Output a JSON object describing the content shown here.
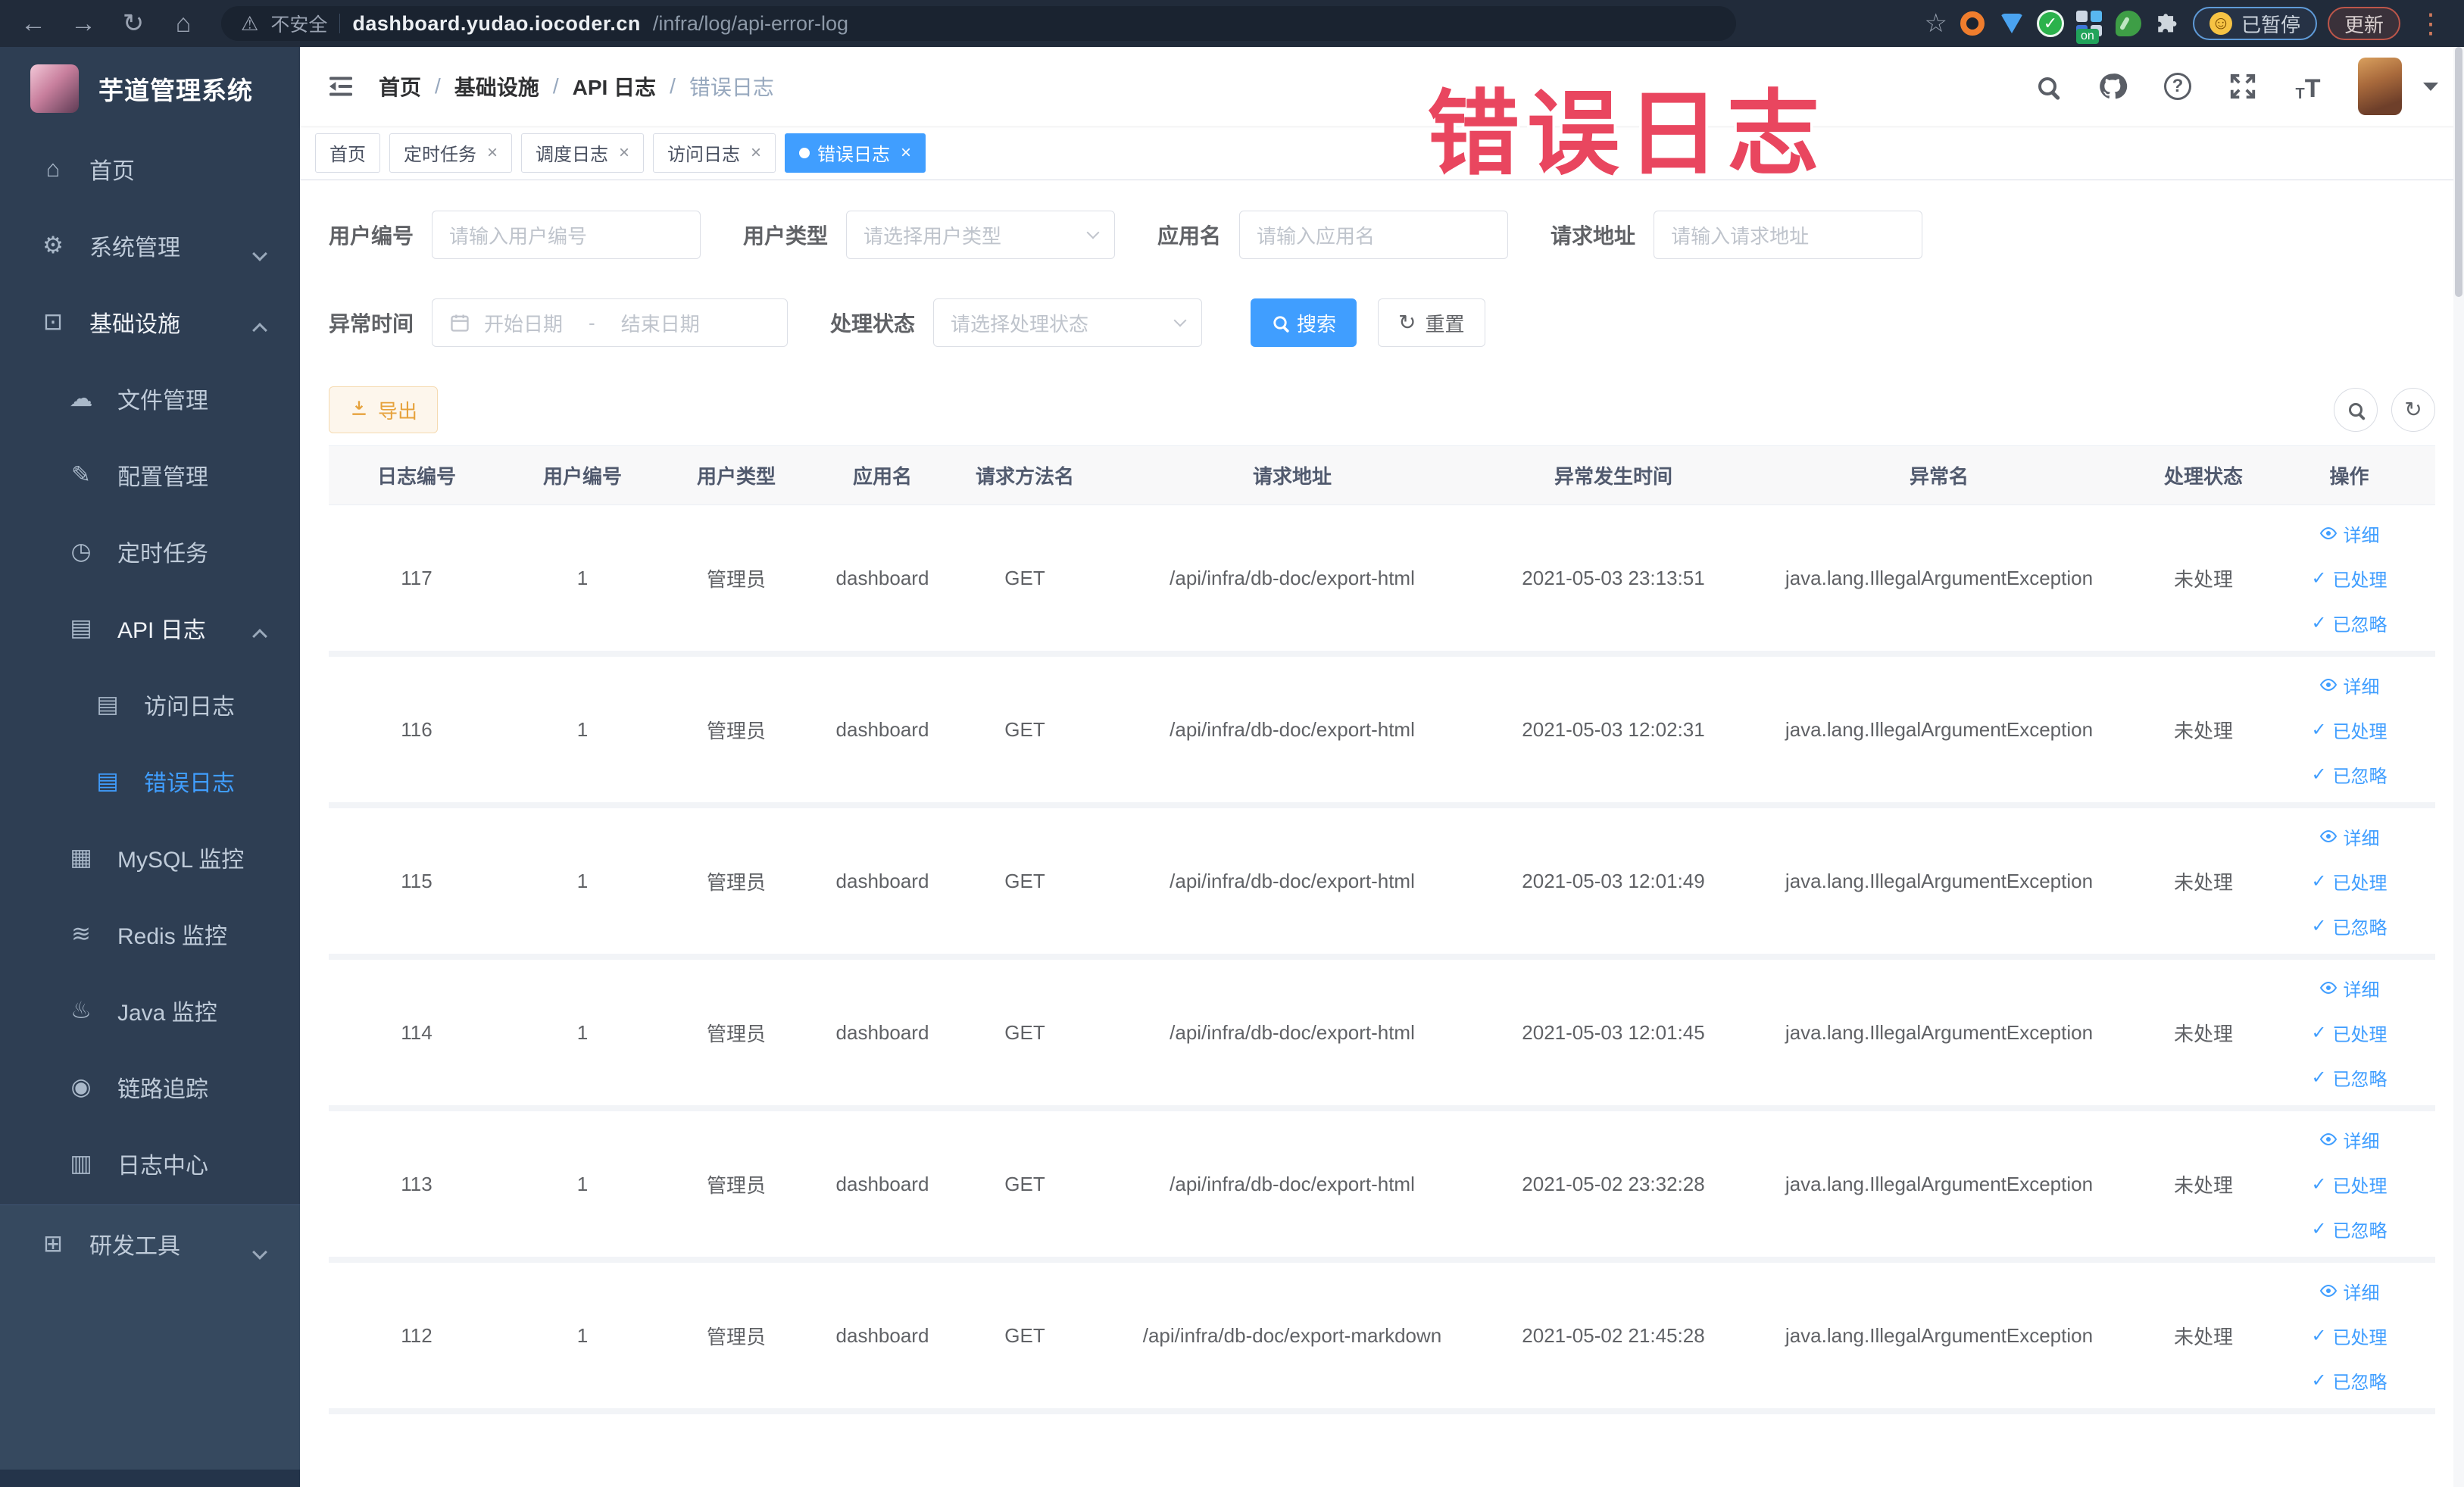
{
  "theme": {
    "accent": "#409eff",
    "warning": "#e6a23c",
    "sidebar_bg": "#2e3e53",
    "sidebar_bg_light": "#36495f",
    "sidebar_text": "#bfcbd9",
    "browser_bar_bg": "#212b3a",
    "annotation_color": "#e9465f"
  },
  "annotation": {
    "text": "错误日志"
  },
  "browser": {
    "security_label": "不安全",
    "url_domain": "dashboard.yudao.iocoder.cn",
    "url_path": "/infra/log/api-error-log",
    "paused_label": "已暂停",
    "update_label": "更新",
    "extension_on_badge": "on"
  },
  "sidebar": {
    "title": "芋道管理系统",
    "items": [
      {
        "id": "home",
        "label": "首页",
        "icon": "home-icon",
        "level": 1
      },
      {
        "id": "system",
        "label": "系统管理",
        "icon": "gear-icon",
        "level": 1,
        "arrow": "down"
      },
      {
        "id": "infra",
        "label": "基础设施",
        "icon": "monitor-icon",
        "level": 1,
        "arrow": "up",
        "highlight": true
      },
      {
        "id": "file",
        "label": "文件管理",
        "icon": "cloud-icon",
        "level": 2
      },
      {
        "id": "config",
        "label": "配置管理",
        "icon": "edit-icon",
        "level": 2
      },
      {
        "id": "job",
        "label": "定时任务",
        "icon": "clock-icon",
        "level": 2
      },
      {
        "id": "api-log",
        "label": "API 日志",
        "icon": "log-icon",
        "level": 2,
        "arrow": "up",
        "highlight": true
      },
      {
        "id": "access-log",
        "label": "访问日志",
        "icon": "log-icon",
        "level": 3
      },
      {
        "id": "error-log",
        "label": "错误日志",
        "icon": "log-icon",
        "level": 3,
        "active": true
      },
      {
        "id": "mysql",
        "label": "MySQL 监控",
        "icon": "database-icon",
        "level": 2
      },
      {
        "id": "redis",
        "label": "Redis 监控",
        "icon": "redis-icon",
        "level": 2
      },
      {
        "id": "java",
        "label": "Java 监控",
        "icon": "java-icon",
        "level": 2
      },
      {
        "id": "trace",
        "label": "链路追踪",
        "icon": "eye-icon",
        "level": 2
      },
      {
        "id": "log-center",
        "label": "日志中心",
        "icon": "log-center-icon",
        "level": 2
      },
      {
        "id": "dev-tools",
        "label": "研发工具",
        "icon": "tool-icon",
        "level": 1,
        "arrow": "down",
        "section": "light"
      }
    ]
  },
  "navbar": {
    "breadcrumb": [
      "首页",
      "基础设施",
      "API 日志",
      "错误日志"
    ],
    "icons": [
      "search-icon",
      "github-icon",
      "question-icon",
      "fullscreen-icon",
      "font-size-icon",
      "avatar",
      "chevron-down-icon"
    ]
  },
  "tabs": [
    {
      "id": "home",
      "label": "首页",
      "closable": false,
      "active": false
    },
    {
      "id": "job",
      "label": "定时任务",
      "closable": true,
      "active": false
    },
    {
      "id": "job-log",
      "label": "调度日志",
      "closable": true,
      "active": false
    },
    {
      "id": "access-log",
      "label": "访问日志",
      "closable": true,
      "active": false
    },
    {
      "id": "error-log",
      "label": "错误日志",
      "closable": true,
      "active": true
    }
  ],
  "filters": {
    "user_id": {
      "label": "用户编号",
      "placeholder": "请输入用户编号"
    },
    "user_type": {
      "label": "用户类型",
      "placeholder": "请选择用户类型"
    },
    "app_name": {
      "label": "应用名",
      "placeholder": "请输入应用名"
    },
    "request_url": {
      "label": "请求地址",
      "placeholder": "请输入请求地址"
    },
    "exception_time": {
      "label": "异常时间",
      "start_placeholder": "开始日期",
      "separator": "-",
      "end_placeholder": "结束日期"
    },
    "process_status": {
      "label": "处理状态",
      "placeholder": "请选择处理状态"
    },
    "search_label": "搜索",
    "reset_label": "重置"
  },
  "toolbar": {
    "export_label": "导出"
  },
  "table": {
    "headers": [
      "日志编号",
      "用户编号",
      "用户类型",
      "应用名",
      "请求方法名",
      "请求地址",
      "异常发生时间",
      "异常名",
      "处理状态",
      "操作"
    ],
    "rows": [
      {
        "log_id": "117",
        "user_id": "1",
        "user_type": "管理员",
        "app_name": "dashboard",
        "method": "GET",
        "url": "/api/infra/db-doc/export-html",
        "time": "2021-05-03 23:13:51",
        "exception": "java.lang.IllegalArgumentException",
        "status": "未处理"
      },
      {
        "log_id": "116",
        "user_id": "1",
        "user_type": "管理员",
        "app_name": "dashboard",
        "method": "GET",
        "url": "/api/infra/db-doc/export-html",
        "time": "2021-05-03 12:02:31",
        "exception": "java.lang.IllegalArgumentException",
        "status": "未处理"
      },
      {
        "log_id": "115",
        "user_id": "1",
        "user_type": "管理员",
        "app_name": "dashboard",
        "method": "GET",
        "url": "/api/infra/db-doc/export-html",
        "time": "2021-05-03 12:01:49",
        "exception": "java.lang.IllegalArgumentException",
        "status": "未处理"
      },
      {
        "log_id": "114",
        "user_id": "1",
        "user_type": "管理员",
        "app_name": "dashboard",
        "method": "GET",
        "url": "/api/infra/db-doc/export-html",
        "time": "2021-05-03 12:01:45",
        "exception": "java.lang.IllegalArgumentException",
        "status": "未处理"
      },
      {
        "log_id": "113",
        "user_id": "1",
        "user_type": "管理员",
        "app_name": "dashboard",
        "method": "GET",
        "url": "/api/infra/db-doc/export-html",
        "time": "2021-05-02 23:32:28",
        "exception": "java.lang.IllegalArgumentException",
        "status": "未处理"
      },
      {
        "log_id": "112",
        "user_id": "1",
        "user_type": "管理员",
        "app_name": "dashboard",
        "method": "GET",
        "url": "/api/infra/db-doc/export-markdown",
        "time": "2021-05-02 21:45:28",
        "exception": "java.lang.IllegalArgumentException",
        "status": "未处理"
      }
    ],
    "actions": [
      {
        "label": "详细",
        "icon": "eye-icon"
      },
      {
        "label": "已处理",
        "icon": "check-icon"
      },
      {
        "label": "已忽略",
        "icon": "check-icon"
      }
    ]
  }
}
